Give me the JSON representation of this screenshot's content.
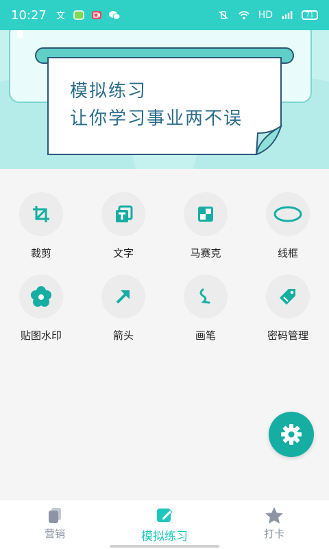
{
  "status": {
    "time": "10:27",
    "network": "HD",
    "battery": "71"
  },
  "banner": {
    "line1": "模拟练习",
    "line2": "让你学习事业两不误"
  },
  "tools": [
    {
      "label": "裁剪",
      "icon": "crop-icon"
    },
    {
      "label": "文字",
      "icon": "text-icon"
    },
    {
      "label": "马赛克",
      "icon": "mosaic-icon"
    },
    {
      "label": "线框",
      "icon": "ellipse-icon"
    },
    {
      "label": "贴图水印",
      "icon": "flower-icon"
    },
    {
      "label": "箭头",
      "icon": "arrow-icon"
    },
    {
      "label": "画笔",
      "icon": "brush-icon"
    },
    {
      "label": "密码管理",
      "icon": "tag-icon"
    }
  ],
  "nav": [
    {
      "label": "营销",
      "icon": "copy-icon",
      "active": false
    },
    {
      "label": "模拟练习",
      "icon": "edit-icon",
      "active": true
    },
    {
      "label": "打卡",
      "icon": "star-icon",
      "active": false
    }
  ],
  "colors": {
    "accent": "#16aea3",
    "status_bar": "#2fd0c6",
    "nav_active": "#1ec7bd",
    "nav_inactive": "#8c94a6"
  }
}
